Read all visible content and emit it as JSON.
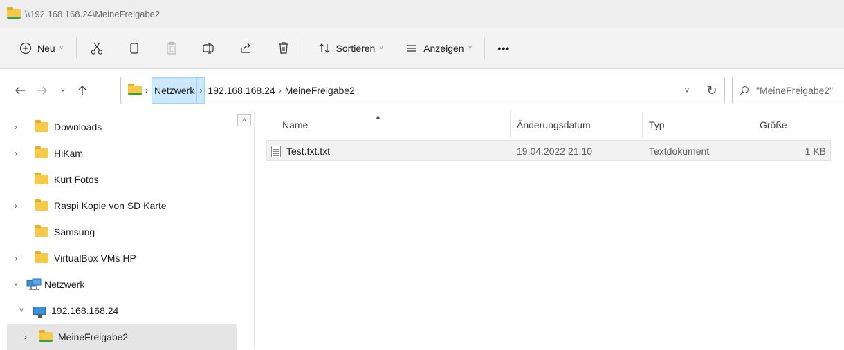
{
  "window": {
    "title": "\\\\192.168.168.24\\MeineFreigabe2"
  },
  "toolbar": {
    "new_label": "Neu",
    "sort_label": "Sortieren",
    "view_label": "Anzeigen",
    "more_label": "•••"
  },
  "address": {
    "crumbs": [
      "Netzwerk",
      "192.168.168.24",
      "MeineFreigabe2"
    ]
  },
  "search": {
    "placeholder": "\"MeineFreigabe2\""
  },
  "sidebar": {
    "items": [
      {
        "label": "Downloads",
        "expandable": true
      },
      {
        "label": "HiKam",
        "expandable": true
      },
      {
        "label": "Kurt Fotos",
        "expandable": false
      },
      {
        "label": "Raspi Kopie von SD Karte",
        "expandable": true
      },
      {
        "label": "Samsung",
        "expandable": false
      },
      {
        "label": "VirtualBox VMs HP",
        "expandable": true
      },
      {
        "label": "Netzwerk",
        "expanded": true
      },
      {
        "label": "192.168.168.24",
        "expanded": true
      },
      {
        "label": "MeineFreigabe2",
        "selected": true
      }
    ]
  },
  "columns": [
    "Name",
    "Änderungsdatum",
    "Typ",
    "Größe"
  ],
  "files": [
    {
      "name": "Test.txt.txt",
      "date": "19.04.2022 21:10",
      "type": "Textdokument",
      "size": "1 KB"
    }
  ]
}
